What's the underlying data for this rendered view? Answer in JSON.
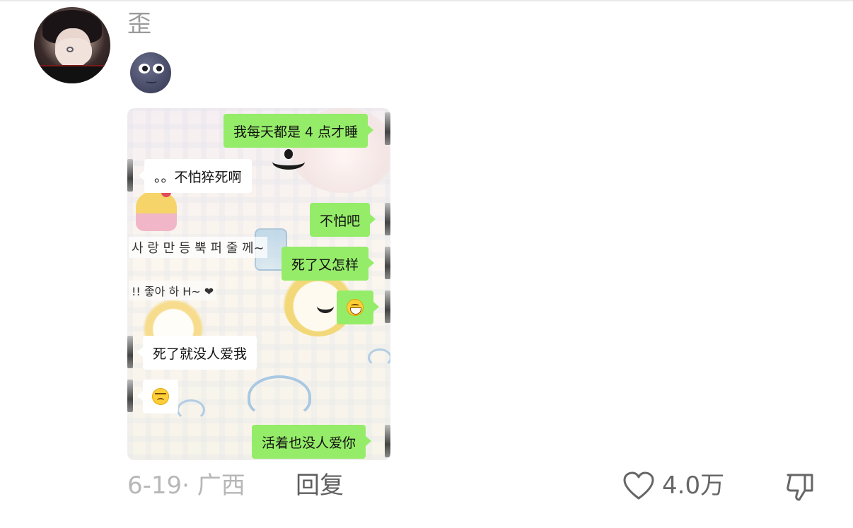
{
  "comment": {
    "username": "歪",
    "meta": "6-19· 广西",
    "reply_label": "回复",
    "like_count": "4.0万"
  },
  "chat_image": {
    "decor_text": [
      "사 랑 만 등 뿍 퍼 줄 께~",
      "!! 좋아 하 H~ ❤"
    ],
    "messages": [
      {
        "side": "out",
        "text": "我每天都是 4 点才睡"
      },
      {
        "side": "in",
        "text": "。。不怕猝死啊"
      },
      {
        "side": "out",
        "text": "不怕吧"
      },
      {
        "side": "out",
        "text": "死了又怎样"
      },
      {
        "side": "out",
        "emoji": "grinning-face-icon"
      },
      {
        "side": "in",
        "text": "死了就没人爱我"
      },
      {
        "side": "in",
        "emoji": "sad-face-icon"
      },
      {
        "side": "out",
        "text": "活着也没人爱你"
      }
    ]
  },
  "icons": {
    "avatar": "avatar",
    "reaction_emoji": "moon-face-icon",
    "like": "heart-outline-icon",
    "dislike": "thumbs-down-icon"
  },
  "colors": {
    "outgoing_bubble": "#95ec69",
    "incoming_bubble": "#ffffff",
    "meta_text": "#b7b7b7",
    "reply_text": "#5e5e5e"
  }
}
